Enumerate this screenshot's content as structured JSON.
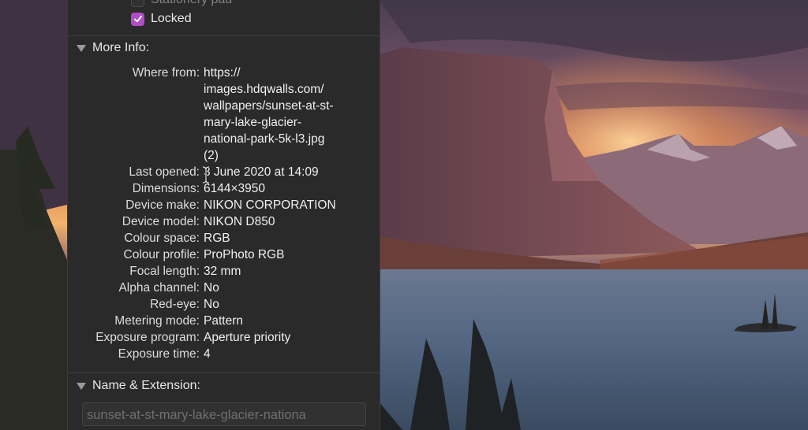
{
  "checkboxes": {
    "stationery": {
      "label": "Stationery pad",
      "checked": false
    },
    "locked": {
      "label": "Locked",
      "checked": true
    }
  },
  "more_info": {
    "title": "More Info:",
    "rows": [
      {
        "label": "Where from:",
        "value": "https://\nimages.hdqwalls.com/\nwallpapers/sunset-at-st-\nmary-lake-glacier-\nnational-park-5k-l3.jpg\n(2)"
      },
      {
        "label": "Last opened:",
        "value": "3 June 2020 at 14:09"
      },
      {
        "label": "Dimensions:",
        "value": "6144×3950"
      },
      {
        "label": "Device make:",
        "value": "NIKON CORPORATION"
      },
      {
        "label": "Device model:",
        "value": "NIKON D850"
      },
      {
        "label": "Colour space:",
        "value": "RGB"
      },
      {
        "label": "Colour profile:",
        "value": "ProPhoto RGB"
      },
      {
        "label": "Focal length:",
        "value": "32 mm"
      },
      {
        "label": "Alpha channel:",
        "value": "No"
      },
      {
        "label": "Red-eye:",
        "value": "No"
      },
      {
        "label": "Metering mode:",
        "value": "Pattern"
      },
      {
        "label": "Exposure program:",
        "value": "Aperture priority"
      },
      {
        "label": "Exposure time:",
        "value": "4"
      }
    ]
  },
  "name_extension": {
    "title": "Name & Extension:",
    "filename": "sunset-at-st-mary-lake-glacier-nationa"
  },
  "colors": {
    "panel_bg": "#2b2a2a",
    "checkbox_accent": "#b14cc7"
  }
}
